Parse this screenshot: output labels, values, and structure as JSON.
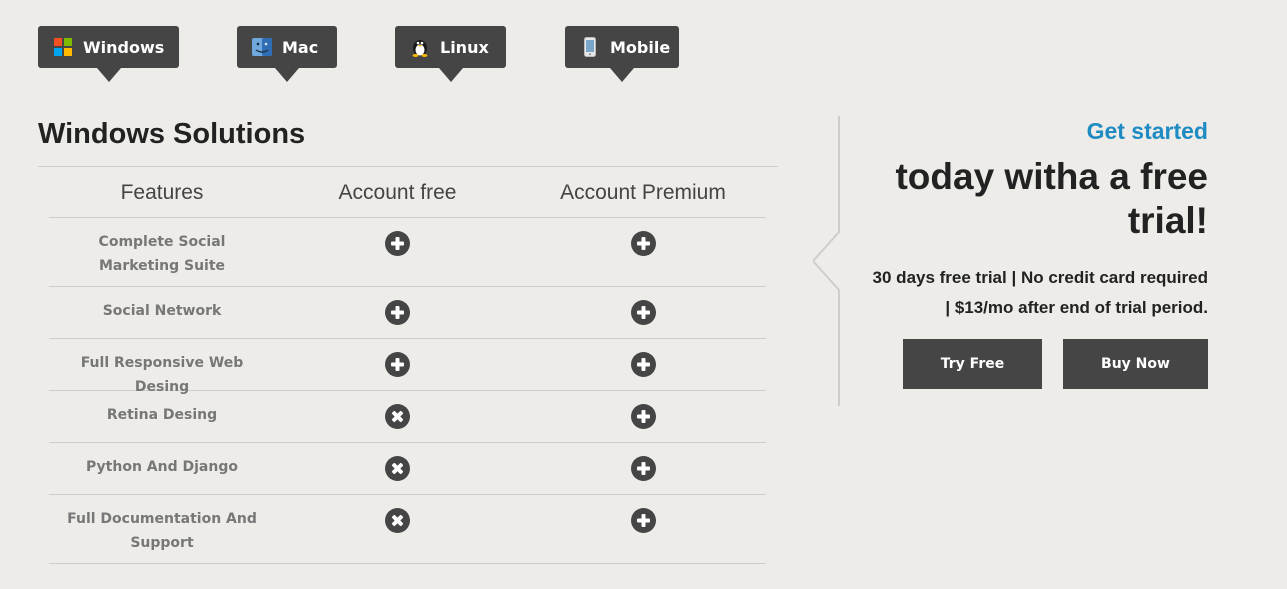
{
  "tabs": [
    {
      "label": "Windows",
      "icon": "windows-logo-icon"
    },
    {
      "label": "Mac",
      "icon": "mac-finder-icon"
    },
    {
      "label": "Linux",
      "icon": "linux-penguin-icon"
    },
    {
      "label": "Mobile",
      "icon": "mobile-phone-icon"
    }
  ],
  "section": {
    "title": "Windows Solutions"
  },
  "table": {
    "headers": [
      "Features",
      "Account free",
      "Account Premium"
    ],
    "rows": [
      {
        "feature": "Complete Social Marketing Suite",
        "free": "plus",
        "premium": "plus"
      },
      {
        "feature": "Social Network",
        "free": "plus",
        "premium": "plus"
      },
      {
        "feature": "Full Responsive Web Desing",
        "free": "plus",
        "premium": "plus"
      },
      {
        "feature": "Retina Desing",
        "free": "cross",
        "premium": "plus"
      },
      {
        "feature": "Python And Django",
        "free": "cross",
        "premium": "plus"
      },
      {
        "feature": "Full Documentation And Support",
        "free": "cross",
        "premium": "plus"
      }
    ]
  },
  "promo": {
    "get_started": "Get started",
    "headline_line1": "today witha a free",
    "headline_line2": "trial!",
    "trial_line1": "30 days free trial | No credit card required",
    "trial_line2": "| $13/mo after end of trial period.",
    "try_label": "Try Free",
    "buy_label": "Buy Now"
  },
  "colors": {
    "accent": "#1e8bc3",
    "dark": "#454545",
    "background": "#eeece9"
  }
}
